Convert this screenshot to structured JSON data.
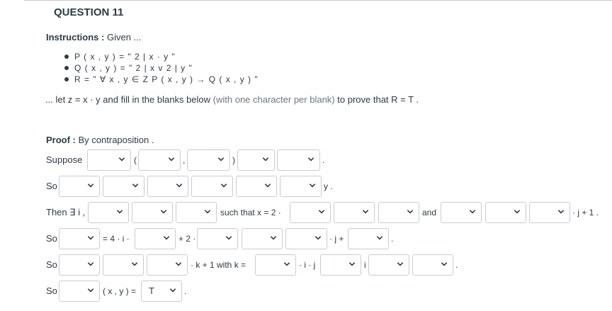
{
  "question": {
    "title": "QUESTION 11",
    "instructions_label": "Instructions :",
    "instructions_text": "Given ...",
    "bullets": [
      "P ( x , y ) = \" 2 | x · y \"",
      "Q ( x , y ) = \" 2 | x v 2 | y \"",
      "R = \" ∀ x , y ∈ Z P ( x , y ) → Q ( x , y ) \""
    ],
    "let_text_start": "... let z = x · y and fill in the blanks below",
    "let_text_gray": "(with one character per blank)",
    "let_text_end": "to prove that R = T ."
  },
  "proof": {
    "label": "Proof :",
    "method": "By contraposition .",
    "rows": [
      {
        "label": "Suppose",
        "texts": [
          "(",
          ",",
          ")",
          "."
        ]
      },
      {
        "label": "So",
        "texts": [
          "y ."
        ]
      },
      {
        "label": "Then ∃ i ,",
        "texts": [
          "such that x = 2 ·",
          "and",
          "· j + 1 ."
        ]
      },
      {
        "label": "So",
        "texts": [
          "= 4 · i ·",
          "+ 2 ·",
          "· j +",
          "."
        ]
      },
      {
        "label": "So",
        "texts": [
          "· k + 1 with k =",
          "· i · j",
          "i",
          "."
        ]
      },
      {
        "label": "So",
        "texts": [
          "( x , y ) =",
          "."
        ]
      }
    ],
    "selected_value": "T"
  },
  "colors": {
    "text": "#2d3b45",
    "border": "#c7cdd1",
    "muted": "#6b7780"
  },
  "icons": {
    "dropdown": "chevron-down-icon"
  }
}
